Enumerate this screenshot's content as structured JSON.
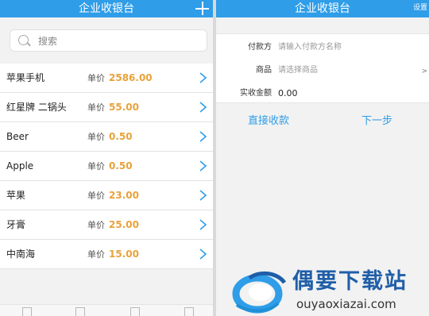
{
  "left": {
    "header": {
      "title": "企业收银台",
      "add_icon": "plus-icon"
    },
    "search": {
      "placeholder": "搜索",
      "icon": "search-icon"
    },
    "unit_label": "单价",
    "products": [
      {
        "name": "苹果手机",
        "price": "2586.00"
      },
      {
        "name": "红星牌 二锅头",
        "price": "55.00"
      },
      {
        "name": "Beer",
        "price": "0.50"
      },
      {
        "name": "Apple",
        "price": "0.50"
      },
      {
        "name": "苹果",
        "price": "23.00"
      },
      {
        "name": "牙膏",
        "price": "25.00"
      },
      {
        "name": "中南海",
        "price": "15.00"
      }
    ],
    "tabbar_icons": [
      "export-icon",
      "box-icon",
      "document-icon",
      "currency-icon"
    ]
  },
  "right": {
    "header": {
      "title": "企业收银台",
      "settings": "设置"
    },
    "form": {
      "payer": {
        "label": "付款方",
        "placeholder": "请输入付款方名称"
      },
      "product": {
        "label": "商品",
        "placeholder": "请选择商品",
        "arrow": ">"
      },
      "amount": {
        "label": "实收金额",
        "value": "0.00"
      }
    },
    "actions": {
      "direct": "直接收款",
      "next": "下一步"
    }
  },
  "watermark": {
    "brand": "偶要下载站",
    "site": "ouyaoxiazai.com"
  },
  "colors": {
    "accent": "#2f9de8",
    "price": "#e8a23a",
    "brand": "#1f5ea8"
  }
}
